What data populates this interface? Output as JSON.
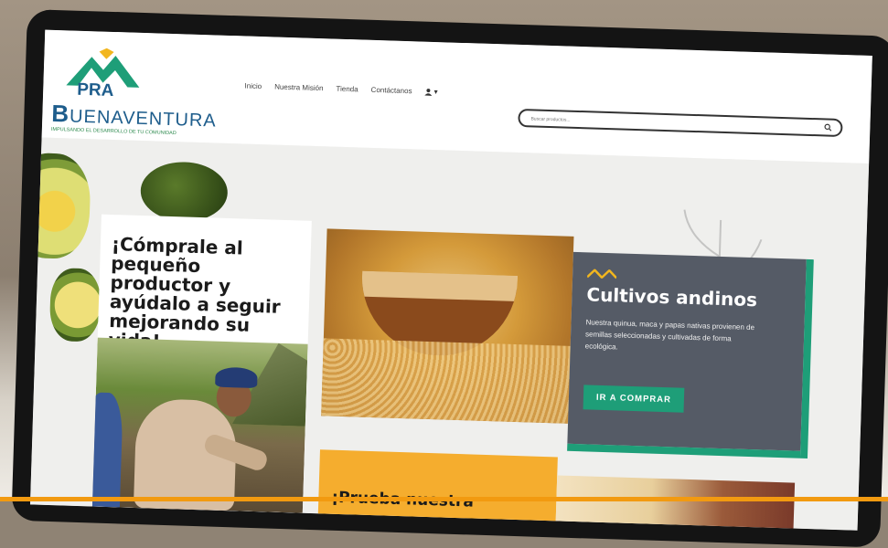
{
  "site": {
    "logo": {
      "acronym": "PRA",
      "name_initial": "B",
      "name_rest": "UENAVENTURA",
      "tagline": "IMPULSANDO EL DESARROLLO DE TU COMUNIDAD"
    },
    "nav": [
      "Inicio",
      "Nuestra Misión",
      "Tienda",
      "Contáctanos"
    ],
    "user_menu_icon": "user-icon",
    "search": {
      "placeholder": "Buscar productos..."
    }
  },
  "promo": {
    "headline": "¡Cómprale al pequeño productor y ayúdalo a seguir mejorando su vida!"
  },
  "feature": {
    "title": "Cultivos andinos",
    "text": "Nuestra quinua, maca y papas nativas provienen de semillas seleccionadas y cultivadas de forma ecológica.",
    "cta": "IR A COMPRAR"
  },
  "second_banner": {
    "title": "¡Prueba nuestra"
  },
  "colors": {
    "brand_blue": "#1e5d8c",
    "brand_green": "#1e9e78",
    "card_gray": "#555b66",
    "accent_orange": "#f5ad2e",
    "logo_yellow": "#f2b61e"
  }
}
